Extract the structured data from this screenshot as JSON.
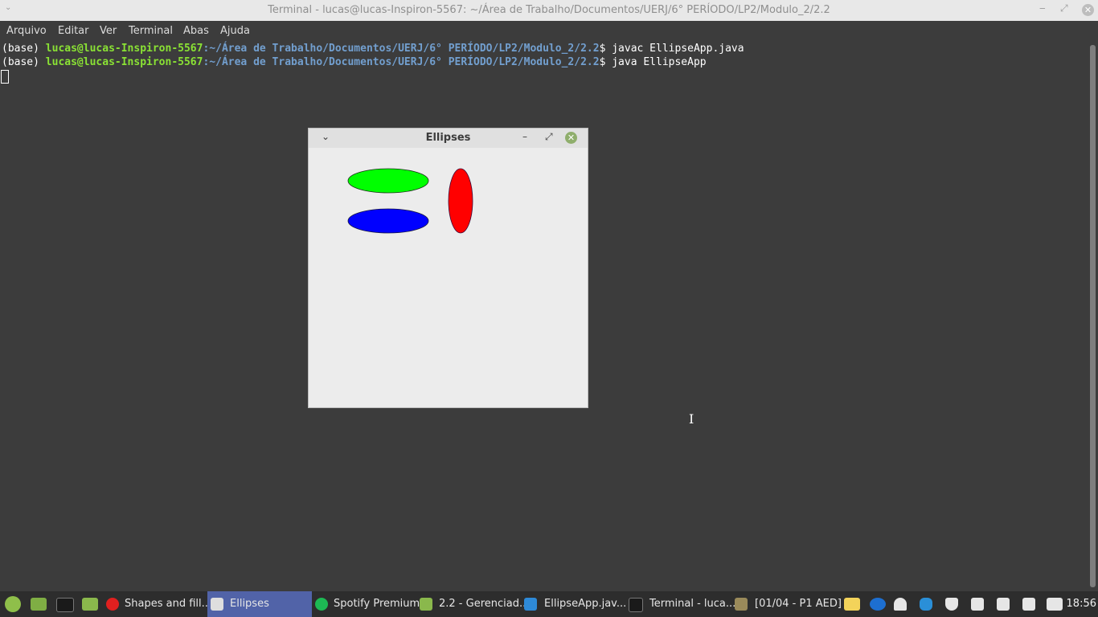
{
  "window": {
    "title": "Terminal - lucas@lucas-Inspiron-5567: ~/Área de Trabalho/Documentos/UERJ/6° PERÍODO/LP2/Modulo_2/2.2",
    "minimize": "‒",
    "maximize": "⤢",
    "close": "✕"
  },
  "menu": [
    "Arquivo",
    "Editar",
    "Ver",
    "Terminal",
    "Abas",
    "Ajuda"
  ],
  "terminal": {
    "lines": [
      {
        "env": "(base) ",
        "user": "lucas@lucas-Inspiron-5567",
        "path": ":~/Área de Trabalho/Documentos/UERJ/6° PERÍODO/LP2/Modulo_2/2.2",
        "prompt": "$ ",
        "cmd": "javac EllipseApp.java"
      },
      {
        "env": "(base) ",
        "user": "lucas@lucas-Inspiron-5567",
        "path": ":~/Área de Trabalho/Documentos/UERJ/6° PERÍODO/LP2/Modulo_2/2.2",
        "prompt": "$ ",
        "cmd": "java EllipseApp"
      }
    ]
  },
  "app_window": {
    "title": "Ellipses",
    "menu_glyph": "⌄",
    "minimize": "–",
    "maximize": "⤢",
    "close": "✕",
    "ellipses": [
      {
        "name": "green-ellipse",
        "fill": "#00ff00"
      },
      {
        "name": "blue-ellipse",
        "fill": "#0000ff"
      },
      {
        "name": "red-ellipse",
        "fill": "#ff0000"
      }
    ]
  },
  "taskbar": {
    "items": [
      {
        "label": "Shapes and fill...",
        "icon": "opera-icon",
        "active": false
      },
      {
        "label": "Ellipses",
        "icon": "java-icon",
        "active": true
      },
      {
        "label": "Spotify Premium",
        "icon": "spotify-icon",
        "active": false
      },
      {
        "label": "2.2 - Gerenciad...",
        "icon": "folder-icon",
        "active": false
      },
      {
        "label": "EllipseApp.jav...",
        "icon": "vscode-icon",
        "active": false
      },
      {
        "label": "Terminal - luca...",
        "icon": "terminal-icon",
        "active": false
      },
      {
        "label": "[01/04 - P1 AED]",
        "icon": "document-icon",
        "active": false
      }
    ],
    "clock": "18:56"
  }
}
